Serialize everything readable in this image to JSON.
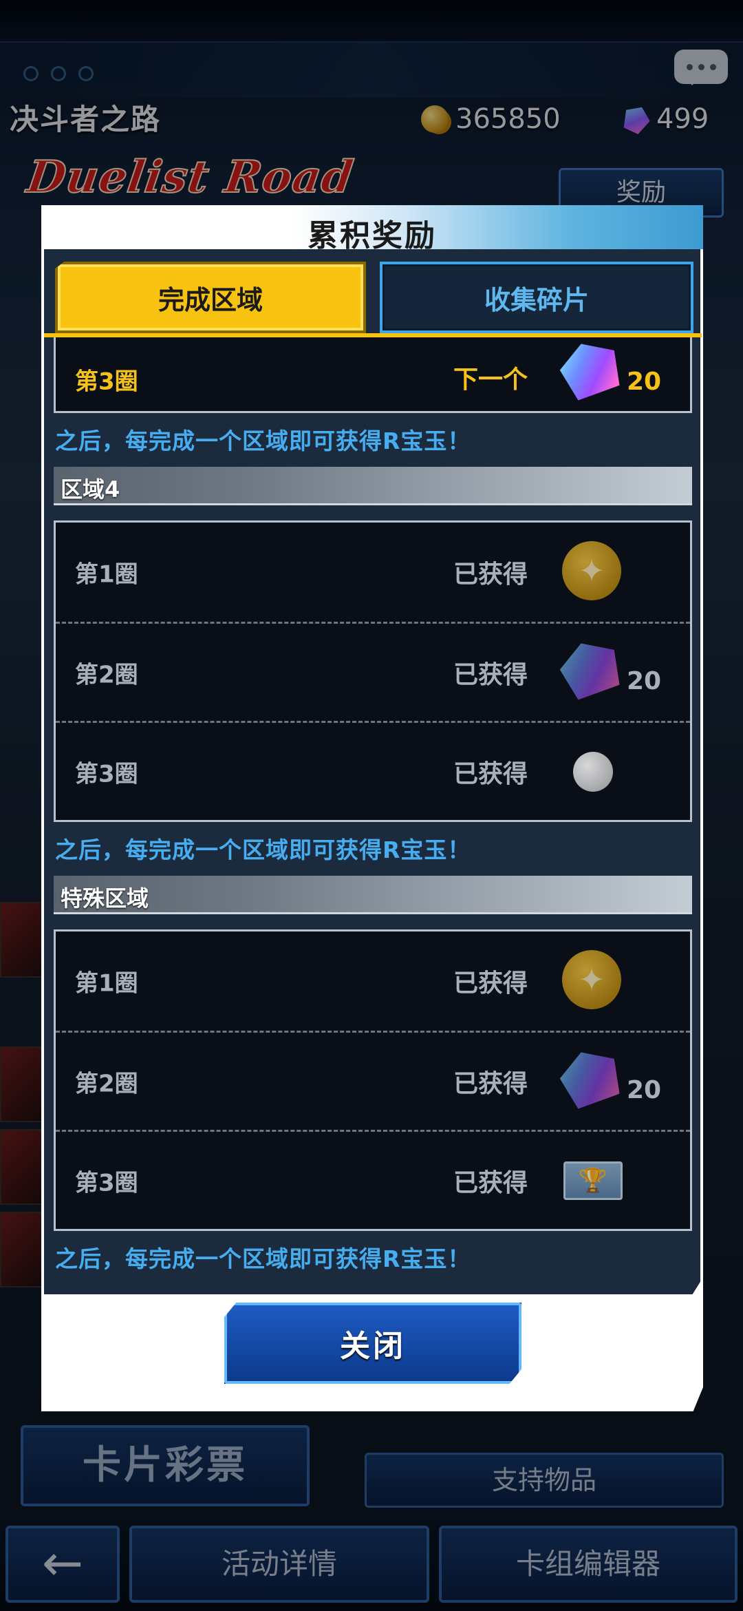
{
  "header": {
    "title": "决斗者之路",
    "coins": "365850",
    "gems": "499",
    "logo_text": "Duelist Road",
    "reward_button": "奖励"
  },
  "modal": {
    "title": "累积奖励",
    "tabs": [
      {
        "label": "完成区域",
        "active": true
      },
      {
        "label": "收集碎片",
        "active": false
      }
    ],
    "top_partial_box": {
      "rows": [
        {
          "label": "第3圈",
          "status": "下一个",
          "icon": "gem-icon",
          "qty": "20",
          "highlight": true
        }
      ]
    },
    "notes": [
      "之后，每完成一个区域即可获得R宝玉！",
      "之后，每完成一个区域即可获得R宝玉！",
      "之后，每完成一个区域即可获得R宝玉！"
    ],
    "sections": [
      {
        "title": "区域4",
        "rows": [
          {
            "label": "第1圈",
            "status": "已获得",
            "icon": "gold-medal-icon",
            "qty": ""
          },
          {
            "label": "第2圈",
            "status": "已获得",
            "icon": "gem-icon",
            "qty": "20"
          },
          {
            "label": "第3圈",
            "status": "已获得",
            "icon": "pearl-icon",
            "qty": ""
          }
        ]
      },
      {
        "title": "特殊区域",
        "rows": [
          {
            "label": "第1圈",
            "status": "已获得",
            "icon": "gold-medal-icon",
            "qty": ""
          },
          {
            "label": "第2圈",
            "status": "已获得",
            "icon": "gem-icon",
            "qty": "20"
          },
          {
            "label": "第3圈",
            "status": "已获得",
            "icon": "trophy-card-icon",
            "qty": ""
          }
        ]
      }
    ],
    "close_button": "关闭"
  },
  "bottom": {
    "lottery_button": "卡片彩票",
    "support_button": "支持物品",
    "nav": {
      "back_icon": "back-arrow-icon",
      "event_details": "活动详情",
      "deck_editor": "卡组编辑器"
    }
  },
  "colors": {
    "accent_gold": "#f8c210",
    "accent_blue": "#46aef0",
    "panel_dark": "#1b2a3c"
  }
}
